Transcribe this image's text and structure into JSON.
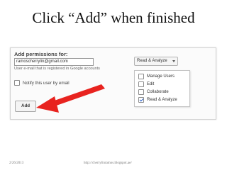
{
  "slide": {
    "title": "Click “Add” when finished",
    "footer_date": "2/26/2013",
    "footer_url": "http://cherrylinramos.blogspot.ae/"
  },
  "permissions": {
    "heading": "Add permissions for:",
    "email_value": "ramoscherrylin@gmail.com",
    "hint": "User e-mail that is registered in Google accounts",
    "notify_label": "Notify this user by email",
    "add_label": "Add",
    "role_selected": "Read & Analyze",
    "role_options": [
      {
        "label": "Manage Users",
        "checked": false
      },
      {
        "label": "Edit",
        "checked": false
      },
      {
        "label": "Collaborate",
        "checked": false
      },
      {
        "label": "Read & Analyze",
        "checked": true
      }
    ]
  },
  "colors": {
    "arrow": "#e8231f",
    "check": "#2b62c9"
  }
}
